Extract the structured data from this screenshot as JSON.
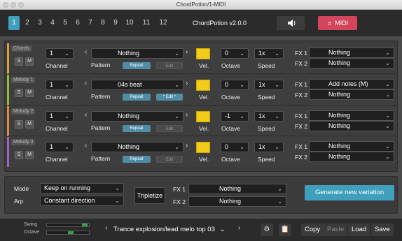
{
  "window": {
    "title": "ChordPotion/1-MIDI"
  },
  "topbar": {
    "numbers": [
      "1",
      "2",
      "3",
      "4",
      "5",
      "6",
      "7",
      "8",
      "9",
      "10",
      "11",
      "12"
    ],
    "active_number": "1",
    "app_version": "ChordPotion v2.0.0",
    "midi_label": "MIDI",
    "speaker_icon": "speaker-icon",
    "note_icon": "music-note-icon"
  },
  "labels": {
    "channel": "Channel",
    "pattern": "Pattern",
    "velocity": "Vel.",
    "octave": "Octave",
    "speed": "Speed",
    "fx1": "FX 1",
    "fx2": "FX 2",
    "repeat": "Repeat",
    "edit": "Edit",
    "edit_active": "* Edit *",
    "solo": "S",
    "mute": "M"
  },
  "tracks": [
    {
      "name": "Chords",
      "channel": "1",
      "pattern": "Nothing",
      "octave": "0",
      "speed": "1x",
      "fx1": "Nothing",
      "fx2": "Nothing",
      "edit_active": false,
      "color": "#d8a33a"
    },
    {
      "name": "Melody 1",
      "channel": "1",
      "pattern": "04s beat",
      "octave": "0",
      "speed": "1x",
      "fx1": "Add notes (M)",
      "fx2": "Nothing",
      "edit_active": true,
      "color": "#8fbf3a"
    },
    {
      "name": "Melody 2",
      "channel": "1",
      "pattern": "Nothing",
      "octave": "-1",
      "speed": "1x",
      "fx1": "Nothing",
      "fx2": "Nothing",
      "edit_active": false,
      "color": "#e08a3a"
    },
    {
      "name": "Melody 3",
      "channel": "1",
      "pattern": "Nothing",
      "octave": "0",
      "speed": "1x",
      "fx1": "Nothing",
      "fx2": "Nothing",
      "edit_active": false,
      "color": "#a35ec9"
    }
  ],
  "bottom": {
    "mode_label": "Mode",
    "mode_value": "Keep on running",
    "arp_label": "Arp",
    "arp_value": "Constant direction",
    "tripletize": "Tripletize",
    "fx1_label": "FX 1",
    "fx1_value": "Nothing",
    "fx2_label": "FX 2",
    "fx2_value": "Nothing",
    "generate": "Generate new variation"
  },
  "footer": {
    "swing_label": "Swing",
    "octave_label": "Octave",
    "preset": "Trance explosion/lead melo top 03",
    "copy": "Copy",
    "paste": "Paste",
    "load": "Load",
    "save": "Save",
    "settings_icon": "gear-icon",
    "clipboard_icon": "clipboard-icon"
  }
}
